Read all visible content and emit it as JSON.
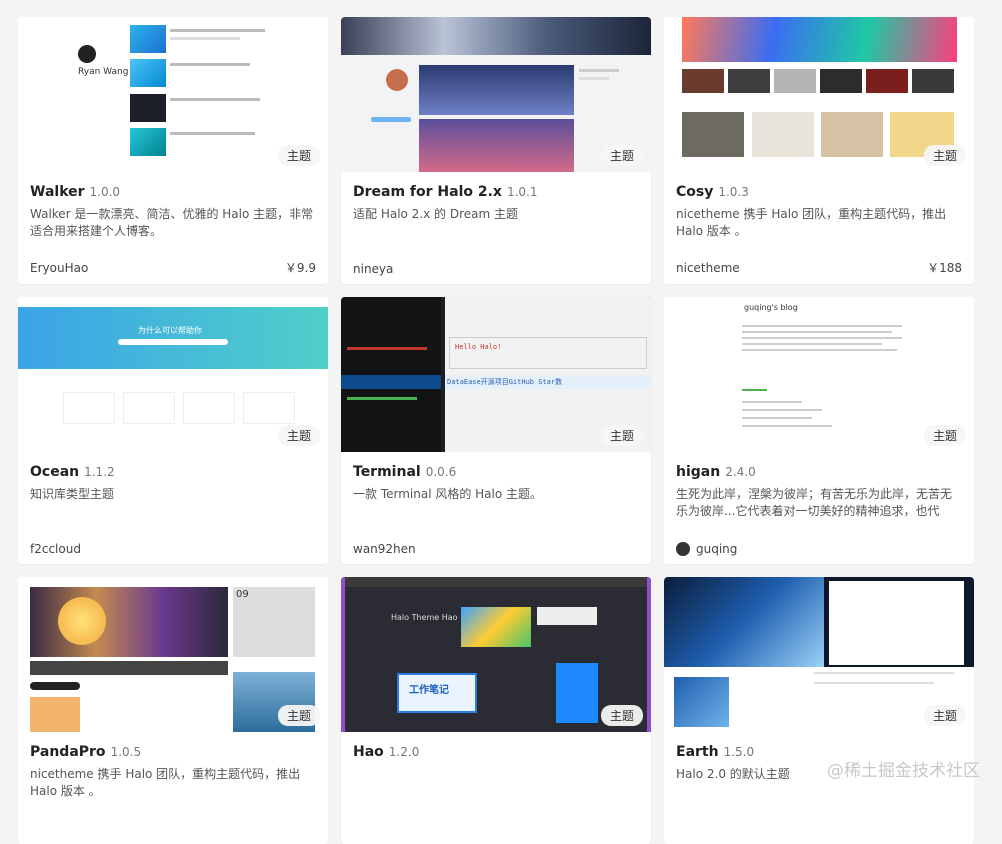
{
  "tag_label": "主题",
  "watermark": "@稀土掘金技术社区",
  "themes": [
    {
      "name": "Walker",
      "version": "1.0.0",
      "description": "Walker 是一款漂亮、简洁、优雅的 Halo 主题，非常适合用来搭建个人博客。",
      "author": "EryouHao",
      "price": "￥9.9"
    },
    {
      "name": "Dream for Halo 2.x",
      "version": "1.0.1",
      "description": "适配 Halo 2.x 的 Dream 主题",
      "author": "nineya",
      "price": ""
    },
    {
      "name": "Cosy",
      "version": "1.0.3",
      "description": "nicetheme 携手 Halo 团队，重构主题代码，推出 Halo 版本 。",
      "author": "nicetheme",
      "price": "￥188"
    },
    {
      "name": "Ocean",
      "version": "1.1.2",
      "description": "知识库类型主题",
      "author": "f2ccloud",
      "price": ""
    },
    {
      "name": "Terminal",
      "version": "0.0.6",
      "description": "一款 Terminal 风格的 Halo 主题。",
      "author": "wan92hen",
      "price": ""
    },
    {
      "name": "higan",
      "version": "2.4.0",
      "description": "生死为此岸，涅槃为彼岸；有苦无乐为此岸，无苦无乐为彼岸...它代表着对一切美好的精神追求，也代表...",
      "author": "guqing",
      "price": ""
    },
    {
      "name": "PandaPro",
      "version": "1.0.5",
      "description": "nicetheme 携手 Halo 团队，重构主题代码，推出 Halo 版本 。",
      "author": "",
      "price": ""
    },
    {
      "name": "Hao",
      "version": "1.2.0",
      "description": "",
      "author": "",
      "price": ""
    },
    {
      "name": "Earth",
      "version": "1.5.0",
      "description": "Halo 2.0 的默认主题",
      "author": "",
      "price": ""
    }
  ],
  "thumb_text": {
    "walker_name": "Ryan Wang",
    "ocean_heading": "为什么可以帮助你",
    "terminal_hello": "Hello Halo!",
    "terminal_post": "DataEase开源项目GitHub Star数",
    "higan_title": "guqing's blog",
    "pandapro_date": "09",
    "hao_title": "Halo Theme Hao",
    "hao_notes": "工作笔记"
  }
}
